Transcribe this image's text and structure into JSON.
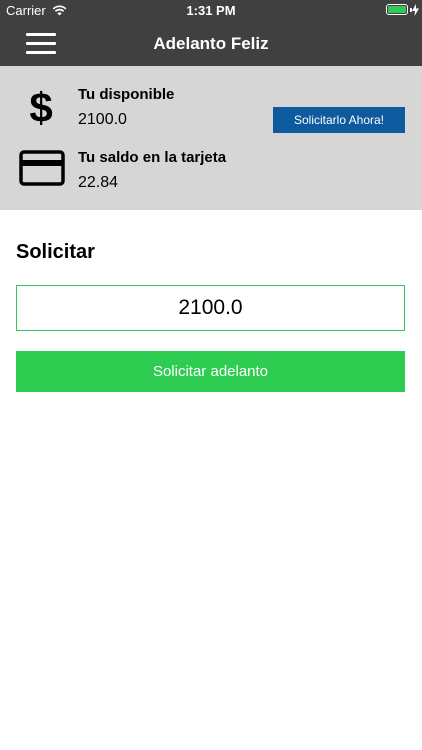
{
  "status_bar": {
    "carrier": "Carrier",
    "time": "1:31 PM",
    "battery_color": "#34c759"
  },
  "nav": {
    "title": "Adelanto Feliz",
    "menu_icon": "hamburger-menu-icon"
  },
  "summary": {
    "available_label": "Tu disponible",
    "available_value": "2100.0",
    "available_icon": "dollar-icon",
    "card_balance_label": "Tu saldo en la tarjeta",
    "card_balance_value": "22.84",
    "card_icon": "credit-card-icon",
    "request_now_label": "Solicitarlo Ahora!",
    "request_now_color": "#0d5a9e"
  },
  "request": {
    "heading": "Solicitar",
    "amount_value": "2100.0",
    "submit_label": "Solicitar adelanto",
    "submit_color": "#2ecc50"
  },
  "colors": {
    "bar_background": "#404040",
    "panel_background": "#d6d6d6",
    "input_border": "#34c759"
  }
}
